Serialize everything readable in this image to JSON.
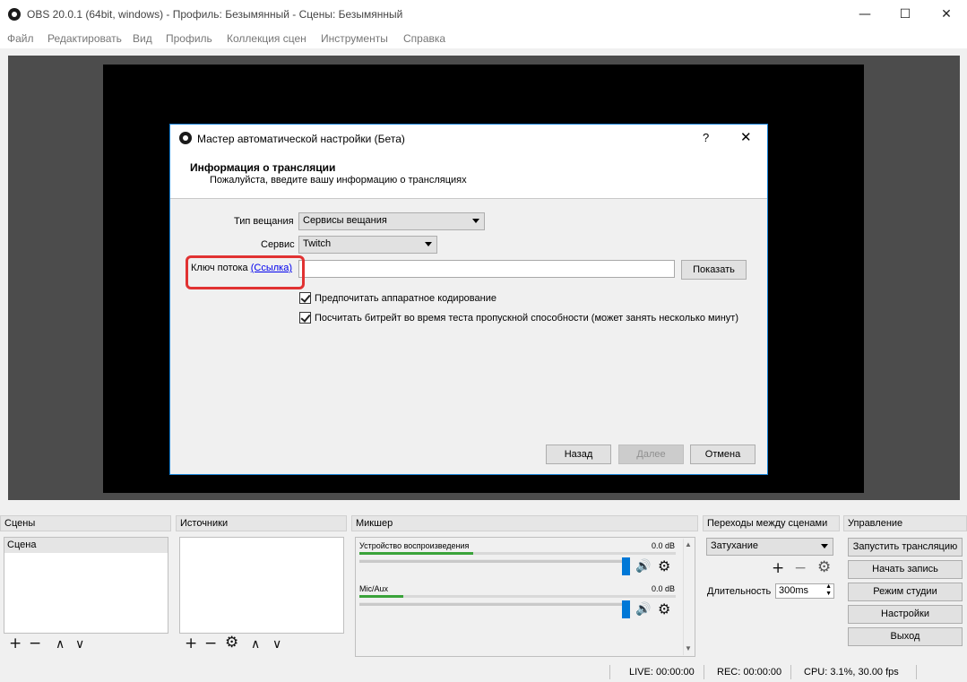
{
  "window": {
    "title": "OBS 20.0.1 (64bit, windows) - Профиль: Безымянный - Сцены: Безымянный",
    "minimize": "—",
    "maximize": "☐",
    "close": "✕"
  },
  "menu": [
    "Файл",
    "Редактировать",
    "Вид",
    "Профиль",
    "Коллекция сцен",
    "Инструменты",
    "Справка"
  ],
  "dialog": {
    "title": "Мастер автоматической настройки (Бета)",
    "help": "?",
    "close": "✕",
    "header_title": "Информация о трансляции",
    "header_subtitle": "Пожалуйста, введите вашу информацию о трансляциях",
    "stream_type_label": "Тип вещания",
    "stream_type_value": "Сервисы вещания",
    "service_label": "Сервис",
    "service_value": "Twitch",
    "stream_key_label": "Ключ потока",
    "stream_key_link": "(Ссылка)",
    "stream_key_value": "",
    "show_button": "Показать",
    "prefer_hardware_label": "Предпочитать аппаратное кодирование",
    "prefer_hardware_checked": true,
    "bitrate_test_label": "Посчитать битрейт во время теста пропускной способности (может занять несколько минут)",
    "bitrate_test_checked": true,
    "back_button": "Назад",
    "next_button": "Далее",
    "cancel_button": "Отмена"
  },
  "docks": {
    "scenes_title": "Сцены",
    "scenes": [
      "Сцена"
    ],
    "sources_title": "Источники",
    "mixer_title": "Микшер",
    "transitions_title": "Переходы между сценами",
    "controls_title": "Управление"
  },
  "mixer": {
    "channels": [
      {
        "name": "Устройство воспроизведения",
        "db": "0.0 dB",
        "level": 0.36
      },
      {
        "name": "Mic/Aux",
        "db": "0.0 dB",
        "level": 0.14
      }
    ]
  },
  "transitions": {
    "selected": "Затухание",
    "duration_label": "Длительность",
    "duration_value": "300ms"
  },
  "controls": [
    "Запустить трансляцию",
    "Начать запись",
    "Режим студии",
    "Настройки",
    "Выход"
  ],
  "toolbar_icons": {
    "add": "+",
    "remove": "−",
    "up": "∧",
    "down": "∨",
    "gear": "⚙",
    "speaker": "🔊"
  },
  "status": {
    "live": "LIVE: 00:00:00",
    "rec": "REC: 00:00:00",
    "cpu": "CPU: 3.1%, 30.00 fps"
  },
  "colors": {
    "accent_blue": "#0078d7",
    "highlight_red": "#e13232",
    "meter_green": "#3aa33a"
  }
}
